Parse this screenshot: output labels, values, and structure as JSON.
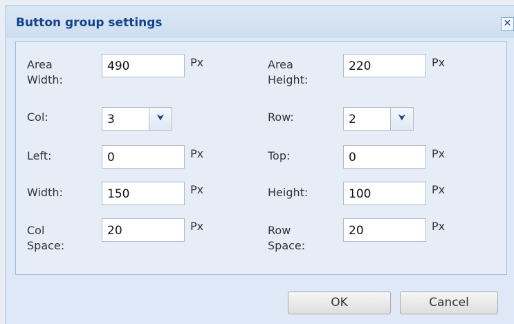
{
  "dialog": {
    "title": "Button group settings",
    "close_glyph": "✕"
  },
  "fields": {
    "area_width": {
      "label_1": "Area",
      "label_2": "Width:",
      "value": "490",
      "unit": "Px"
    },
    "area_height": {
      "label_1": "Area",
      "label_2": "Height:",
      "value": "220",
      "unit": "Px"
    },
    "col": {
      "label": "Col:",
      "value": "3"
    },
    "row": {
      "label": "Row:",
      "value": "2"
    },
    "left": {
      "label": "Left:",
      "value": "0",
      "unit": "Px"
    },
    "top": {
      "label": "Top:",
      "value": "0",
      "unit": "Px"
    },
    "width": {
      "label": "Width:",
      "value": "150",
      "unit": "Px"
    },
    "height": {
      "label": "Height:",
      "value": "100",
      "unit": "Px"
    },
    "col_space": {
      "label_1": "Col",
      "label_2": "Space:",
      "value": "20",
      "unit": "Px"
    },
    "row_space": {
      "label_1": "Row",
      "label_2": "Space:",
      "value": "20",
      "unit": "Px"
    }
  },
  "buttons": {
    "ok": "OK",
    "cancel": "Cancel"
  },
  "icons": {
    "dropdown": "chevron-down-icon",
    "close": "close-icon"
  }
}
